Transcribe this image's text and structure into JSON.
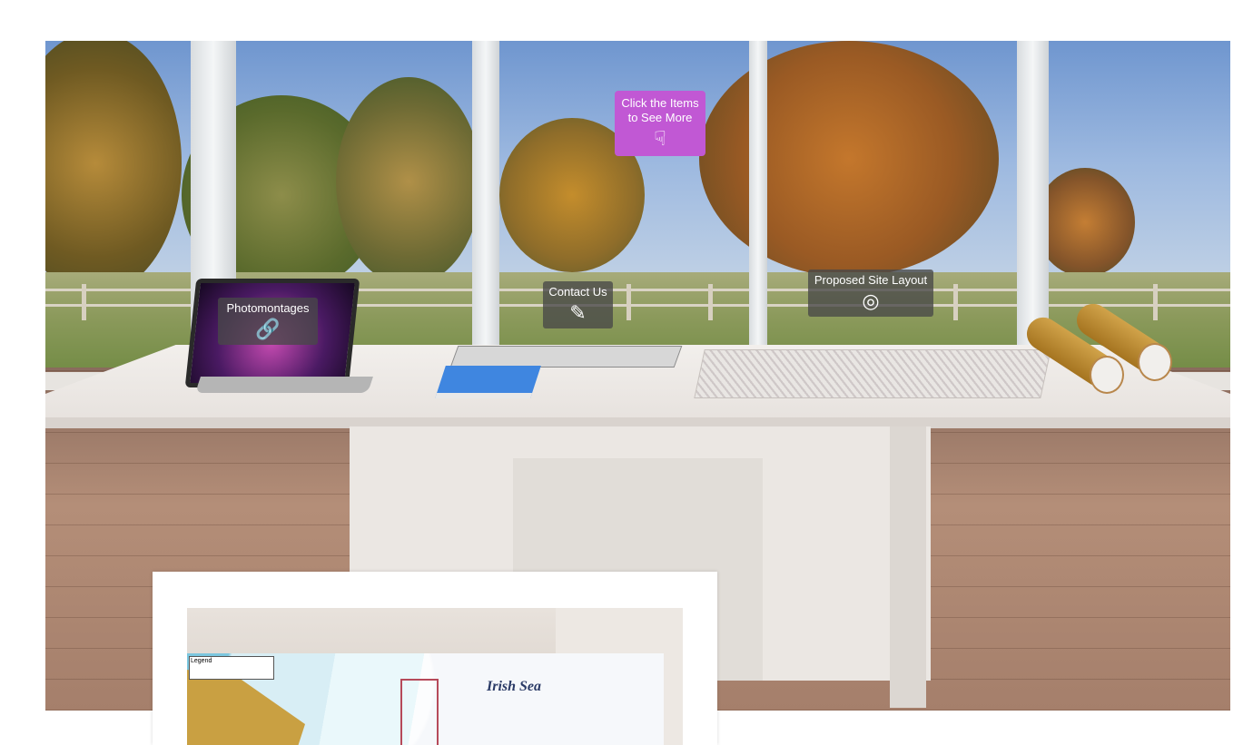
{
  "hotspots": {
    "hint": {
      "label_line1": "Click the Items",
      "label_line2": "to See More",
      "icon": "hand-pointer-down-icon"
    },
    "photomontages": {
      "label": "Photomontages",
      "icon": "link-icon"
    },
    "contact_us": {
      "label": "Contact Us",
      "icon": "pencil-icon"
    },
    "proposed_site_layout": {
      "label": "Proposed Site Layout",
      "icon": "target-icon"
    }
  },
  "inset": {
    "legend_title": "Legend",
    "sea_label": "Irish Sea"
  },
  "colors": {
    "hint_background": "#c158d4",
    "hotspot_background": "#484848"
  }
}
